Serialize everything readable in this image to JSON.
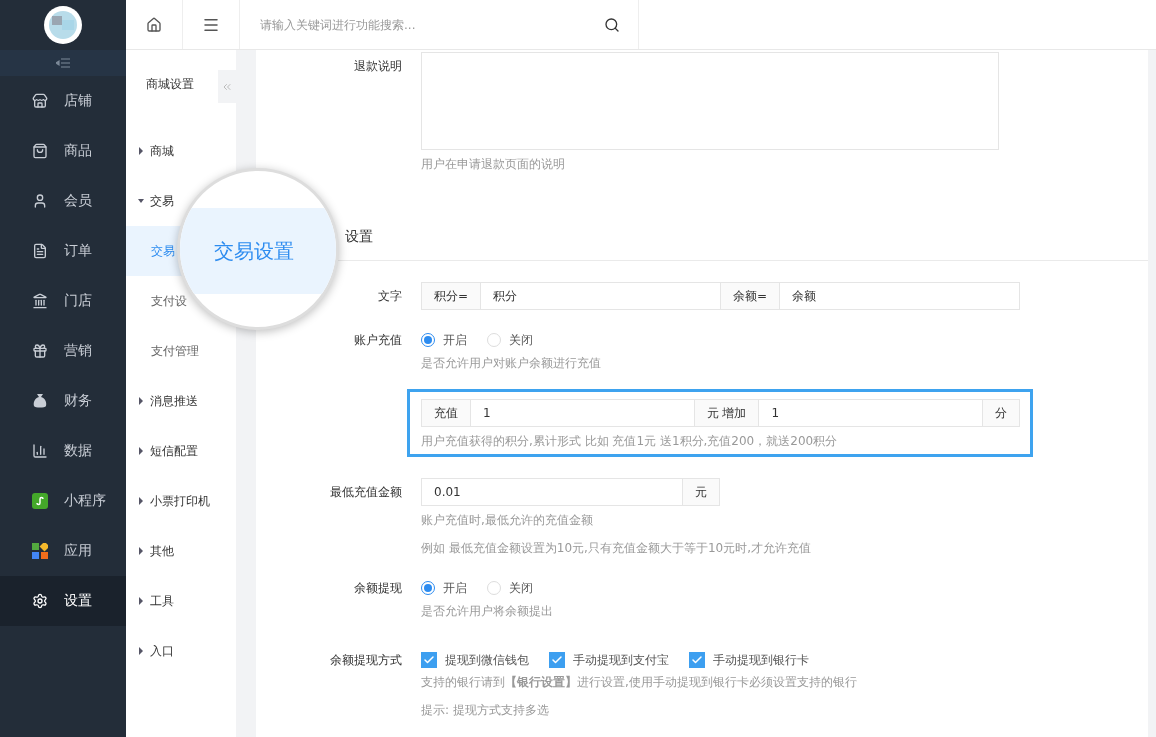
{
  "sidebar": {
    "items": [
      {
        "label": "店铺",
        "selected": false
      },
      {
        "label": "商品",
        "selected": false
      },
      {
        "label": "会员",
        "selected": false
      },
      {
        "label": "订单",
        "selected": false
      },
      {
        "label": "门店",
        "selected": false
      },
      {
        "label": "营销",
        "selected": false
      },
      {
        "label": "财务",
        "selected": false
      },
      {
        "label": "数据",
        "selected": false
      },
      {
        "label": "小程序",
        "selected": false
      },
      {
        "label": "应用",
        "selected": false
      },
      {
        "label": "设置",
        "selected": true
      }
    ]
  },
  "topbar": {
    "search": {
      "placeholder": "请输入关键词进行功能搜索..."
    }
  },
  "subnav": {
    "title": "商城设置",
    "items": [
      {
        "label": "商城",
        "expanded": false
      },
      {
        "label": "交易",
        "expanded": true,
        "children": [
          {
            "label": "交易",
            "selected": true
          },
          {
            "label": "支付设",
            "selected": false
          },
          {
            "label": "支付管理",
            "selected": false
          }
        ]
      },
      {
        "label": "消息推送",
        "expanded": false
      },
      {
        "label": "短信配置",
        "expanded": false
      },
      {
        "label": "小票打印机",
        "expanded": false
      },
      {
        "label": "其他",
        "expanded": false
      },
      {
        "label": "工具",
        "expanded": false
      },
      {
        "label": "入口",
        "expanded": false
      }
    ]
  },
  "magnifier": {
    "text": "交易设置"
  },
  "form": {
    "sections": [
      {
        "fields": [
          {
            "kind": "textarea",
            "label": "退款说明",
            "help": [
              "用户在申请退款页面的说明"
            ]
          }
        ]
      },
      {
        "title": "设置",
        "fields": [
          {
            "kind": "addons",
            "label": "文字",
            "parts": [
              {
                "kind": "addon",
                "text": "积分="
              },
              {
                "kind": "input",
                "value": "积分"
              },
              {
                "kind": "addon",
                "text": "余额="
              },
              {
                "kind": "input",
                "value": "余额"
              }
            ]
          },
          {
            "kind": "radio",
            "label": "账户充值",
            "options": [
              {
                "label": "开启",
                "selected": true
              },
              {
                "label": "关闭",
                "selected": false
              }
            ],
            "help": [
              "是否允许用户对账户余额进行充值"
            ]
          },
          {
            "kind": "addons",
            "highlighted": true,
            "parts": [
              {
                "kind": "addon",
                "text": "充值"
              },
              {
                "kind": "input",
                "value": "1"
              },
              {
                "kind": "addon",
                "text": "元 增加"
              },
              {
                "kind": "input",
                "value": "1"
              },
              {
                "kind": "addon",
                "text": "分"
              }
            ],
            "help": [
              "用户充值获得的积分,累计形式 比如 充值1元 送1积分,充值200，就送200积分"
            ]
          },
          {
            "kind": "addons",
            "label": "最低充值金额",
            "parts": [
              {
                "kind": "input",
                "value": "0.01"
              },
              {
                "kind": "addon",
                "text": "元"
              }
            ],
            "help": [
              "账户充值时,最低允许的充值金额",
              "例如 最低充值金额设置为10元,只有充值金额大于等于10元时,才允许充值"
            ]
          },
          {
            "kind": "radio",
            "label": "余额提现",
            "options": [
              {
                "label": "开启",
                "selected": true
              },
              {
                "label": "关闭",
                "selected": false
              }
            ],
            "help": [
              "是否允许用户将余额提出"
            ]
          },
          {
            "kind": "checkbox",
            "label": "余额提现方式",
            "options": [
              {
                "label": "提现到微信钱包",
                "checked": true
              },
              {
                "label": "手动提现到支付宝",
                "checked": true
              },
              {
                "label": "手动提现到银行卡",
                "checked": true
              }
            ],
            "help": [
              "支持的银行请到**【银行设置】**进行设置,使用手动提现到银行卡必须设置支持的银行",
              "提示: 提现方式支持多选"
            ]
          }
        ]
      }
    ]
  }
}
